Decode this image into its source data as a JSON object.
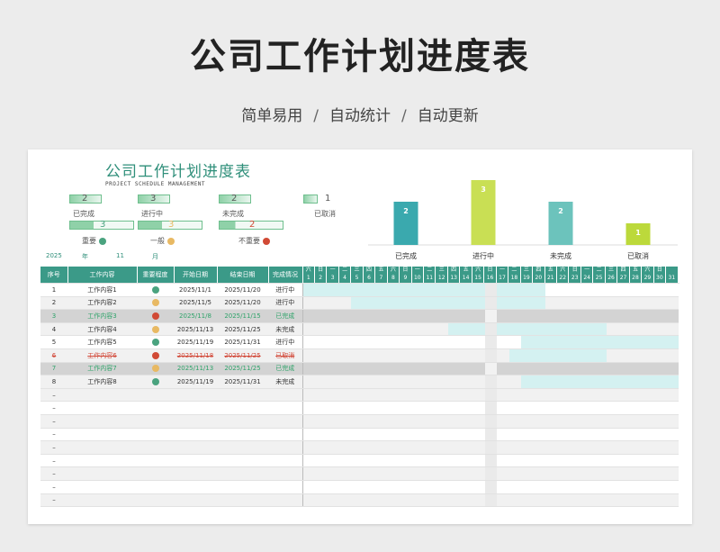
{
  "hero": {
    "title": "公司工作计划进度表",
    "sub1": "简单易用",
    "sub2": "自动统计",
    "sub3": "自动更新",
    "sep": "/"
  },
  "sheet": {
    "title": "公司工作计划进度表",
    "subtitle": "PROJECT SCHEDULE MANAGEMENT"
  },
  "status_kpis": [
    {
      "label": "已完成",
      "value": "2",
      "fill": 0.2
    },
    {
      "label": "进行中",
      "value": "3",
      "fill": 0.3
    },
    {
      "label": "未完成",
      "value": "2",
      "fill": 0.2
    },
    {
      "label": "已取消",
      "value": "1",
      "fill": 0.1
    }
  ],
  "priority_kpis": [
    {
      "label": "重要",
      "value": "3",
      "fill": 0.375,
      "color": "#4aa37f"
    },
    {
      "label": "一般",
      "value": "3",
      "fill": 0.375,
      "color": "#e8b963"
    },
    {
      "label": "不重要",
      "value": "2",
      "fill": 0.25,
      "color": "#d14a35"
    }
  ],
  "date": {
    "year": "2025",
    "year_label": "年",
    "month": "11",
    "month_label": "月"
  },
  "chart_data": {
    "type": "bar",
    "categories": [
      "已完成",
      "进行中",
      "未完成",
      "已取消"
    ],
    "values": [
      2,
      3,
      2,
      1
    ],
    "colors": [
      "#3aa9ae",
      "#c9df54",
      "#6cc3bc",
      "#bcd93b"
    ],
    "ylim": [
      0,
      3
    ]
  },
  "table": {
    "headers": [
      "序号",
      "工作内容",
      "重要程度",
      "开始日期",
      "结束日期",
      "完成情况"
    ],
    "weekdays": [
      "六",
      "日",
      "一",
      "二",
      "三",
      "四",
      "五",
      "六",
      "日",
      "一",
      "二",
      "三",
      "四",
      "五",
      "六",
      "日",
      "一",
      "二",
      "三",
      "四",
      "五",
      "六",
      "日",
      "一",
      "二",
      "三",
      "四",
      "五",
      "六",
      "日"
    ],
    "days": [
      "1",
      "2",
      "3",
      "4",
      "5",
      "6",
      "7",
      "8",
      "9",
      "10",
      "11",
      "12",
      "13",
      "14",
      "15",
      "16",
      "17",
      "18",
      "19",
      "20",
      "21",
      "22",
      "23",
      "24",
      "25",
      "26",
      "27",
      "28",
      "29",
      "30",
      "31"
    ],
    "rows": [
      {
        "no": "1",
        "task": "工作内容1",
        "priority": "#4aa37f",
        "start": "2025/11/1",
        "end": "2025/11/20",
        "status": "进行中",
        "style": "",
        "from": 1,
        "to": 20
      },
      {
        "no": "2",
        "task": "工作内容2",
        "priority": "#e8b963",
        "start": "2025/11/5",
        "end": "2025/11/20",
        "status": "进行中",
        "style": "",
        "from": 5,
        "to": 20
      },
      {
        "no": "3",
        "task": "工作内容3",
        "priority": "#d14a35",
        "start": "2025/11/8",
        "end": "2025/11/15",
        "status": "已完成",
        "style": "done",
        "from": 8,
        "to": 15
      },
      {
        "no": "4",
        "task": "工作内容4",
        "priority": "#e8b963",
        "start": "2025/11/13",
        "end": "2025/11/25",
        "status": "未完成",
        "style": "",
        "from": 13,
        "to": 25
      },
      {
        "no": "5",
        "task": "工作内容5",
        "priority": "#4aa37f",
        "start": "2025/11/19",
        "end": "2025/11/31",
        "status": "进行中",
        "style": "",
        "from": 19,
        "to": 31
      },
      {
        "no": "6",
        "task": "工作内容6",
        "priority": "#d14a35",
        "start": "2025/11/18",
        "end": "2025/11/25",
        "status": "已取消",
        "style": "cancel",
        "from": 18,
        "to": 25
      },
      {
        "no": "7",
        "task": "工作内容7",
        "priority": "#e8b963",
        "start": "2025/11/13",
        "end": "2025/11/25",
        "status": "已完成",
        "style": "done",
        "from": 13,
        "to": 25
      },
      {
        "no": "8",
        "task": "工作内容8",
        "priority": "#4aa37f",
        "start": "2025/11/19",
        "end": "2025/11/31",
        "status": "未完成",
        "style": "",
        "from": 19,
        "to": 31
      }
    ],
    "empty_rows": 9,
    "empty_marker": "–",
    "today_day": 16
  }
}
